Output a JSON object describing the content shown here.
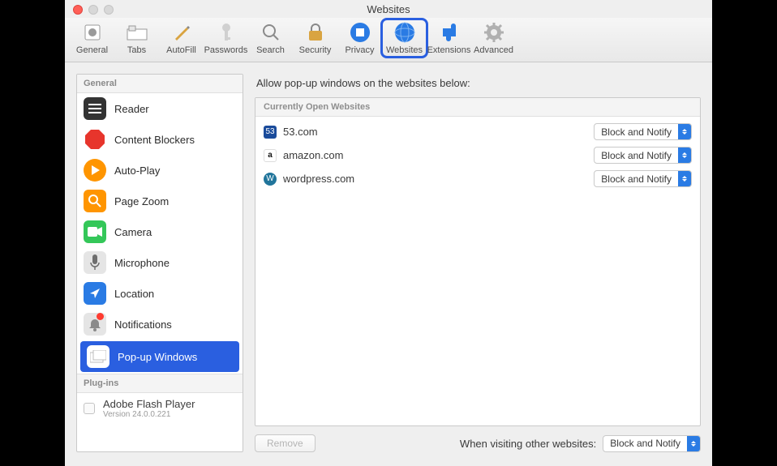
{
  "window": {
    "title": "Websites"
  },
  "toolbar": {
    "items": [
      {
        "label": "General"
      },
      {
        "label": "Tabs"
      },
      {
        "label": "AutoFill"
      },
      {
        "label": "Passwords"
      },
      {
        "label": "Search"
      },
      {
        "label": "Security"
      },
      {
        "label": "Privacy"
      },
      {
        "label": "Websites"
      },
      {
        "label": "Extensions"
      },
      {
        "label": "Advanced"
      }
    ]
  },
  "sidebar": {
    "general_header": "General",
    "items": [
      {
        "label": "Reader"
      },
      {
        "label": "Content Blockers"
      },
      {
        "label": "Auto-Play"
      },
      {
        "label": "Page Zoom"
      },
      {
        "label": "Camera"
      },
      {
        "label": "Microphone"
      },
      {
        "label": "Location"
      },
      {
        "label": "Notifications"
      },
      {
        "label": "Pop-up Windows"
      }
    ],
    "plugins_header": "Plug-ins",
    "plugin": {
      "name": "Adobe Flash Player",
      "version": "Version 24.0.0.221"
    }
  },
  "main": {
    "heading": "Allow pop-up windows on the websites below:",
    "list_header": "Currently Open Websites",
    "rows": [
      {
        "site": "53.com",
        "policy": "Block and Notify"
      },
      {
        "site": "amazon.com",
        "policy": "Block and Notify"
      },
      {
        "site": "wordpress.com",
        "policy": "Block and Notify"
      }
    ],
    "remove_label": "Remove",
    "other_label": "When visiting other websites:",
    "other_policy": "Block and Notify"
  }
}
